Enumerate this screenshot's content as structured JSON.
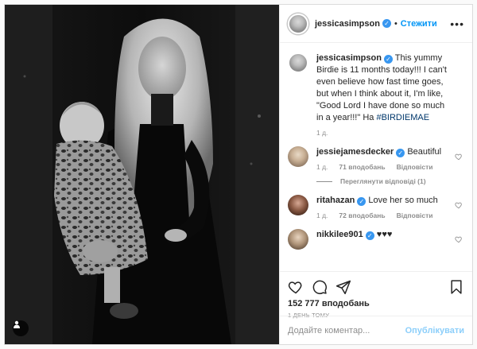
{
  "post": {
    "author": "jessicasimpson",
    "follow_label": "Стежити",
    "more_label": "•••",
    "caption": {
      "username": "jessicasimpson",
      "text": "This yummy Birdie is 11 months today!!! I can't even believe how fast time goes, but when I think about it, I'm like, \"Good Lord I have done so much in a year!!!\" Ha",
      "hashtag": "#BIRDIEMAE",
      "age": "1 д."
    },
    "comments": [
      {
        "username": "jessiejamesdecker",
        "verified": true,
        "text": "Beautiful",
        "age": "1 д.",
        "likes": "71 вподобань",
        "reply": "Відповісти"
      },
      {
        "username": "ritahazan",
        "verified": true,
        "text": "Love her so much",
        "age": "1 д.",
        "likes": "72 вподобань",
        "reply": "Відповісти"
      },
      {
        "username": "nikkilee901",
        "verified": true,
        "text": "♥♥♥"
      }
    ],
    "view_replies": "Переглянути відповіді (1)",
    "likes_count": "152 777 вподобань",
    "timestamp": "1 ДЕНЬ ТОМУ",
    "comment_placeholder": "Додайте коментар...",
    "publish_label": "Опублікувати"
  },
  "colors": {
    "accent": "#0095f6",
    "verified": "#3897f0"
  },
  "icons": {
    "like": "heart-icon",
    "comment": "comment-icon",
    "share": "share-icon",
    "save": "bookmark-icon",
    "tag": "user-tag-icon",
    "check": "✓"
  }
}
